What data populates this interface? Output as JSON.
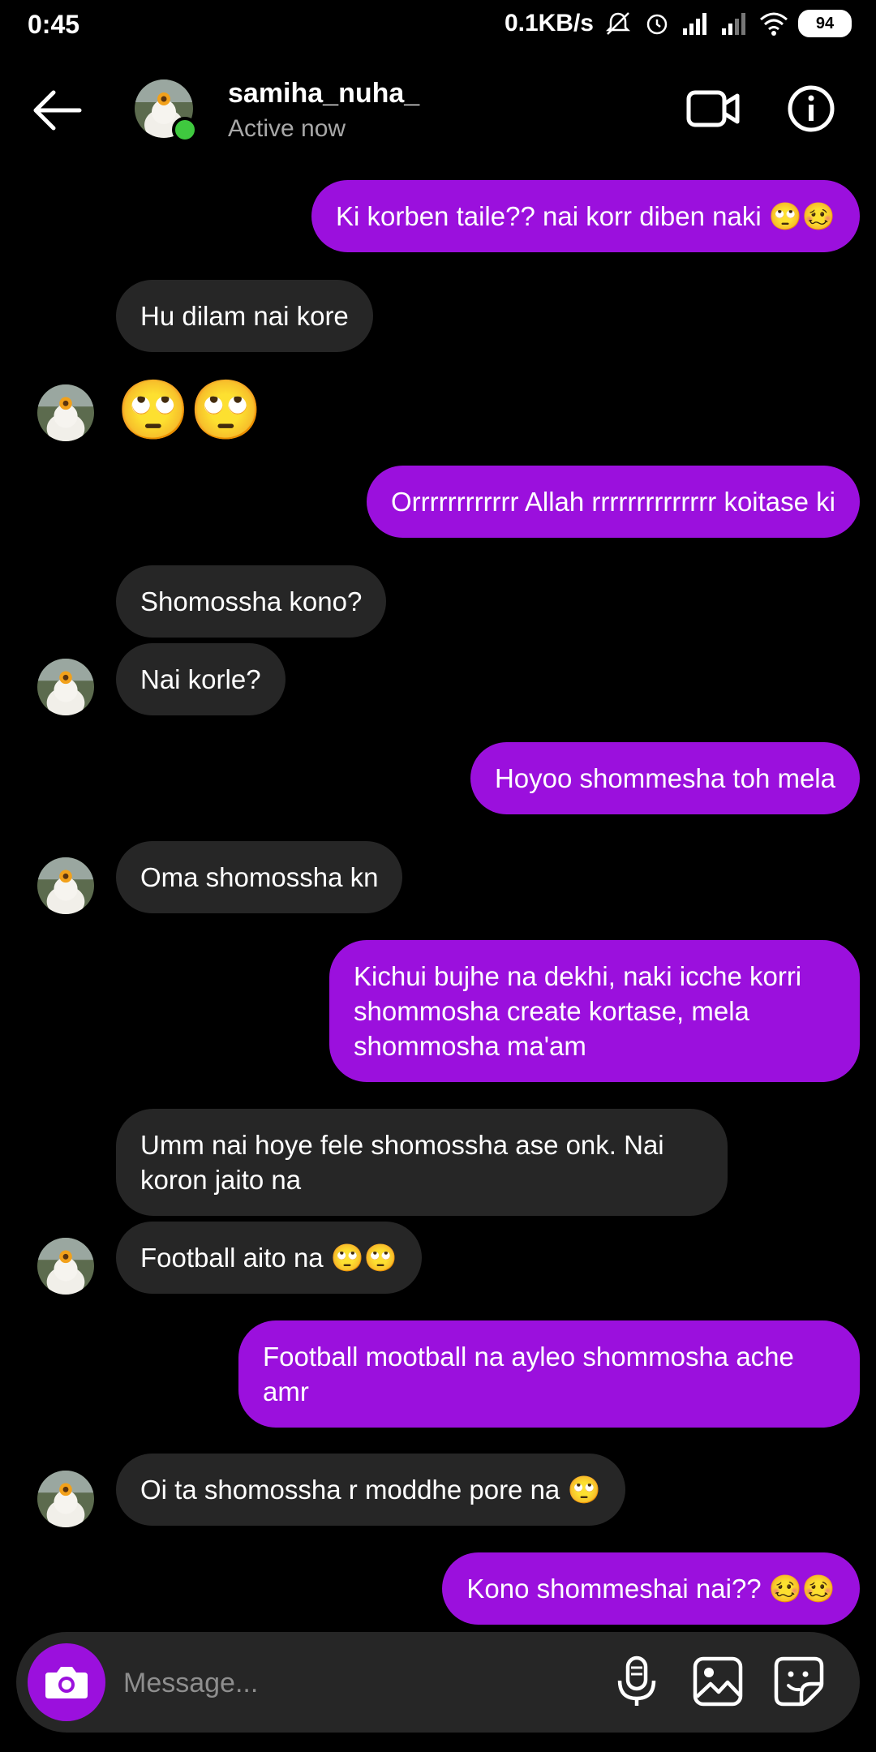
{
  "status_bar": {
    "time": "0:45",
    "net_speed": "0.1KB/s",
    "battery": "94"
  },
  "header": {
    "contact_name": "samiha_nuha_",
    "contact_status": "Active now"
  },
  "messages": [
    {
      "text": "Ki korben taile?? nai korr diben naki 🙄🥴"
    },
    {
      "text": "Hu dilam nai kore"
    },
    {
      "text": "🙄🙄"
    },
    {
      "text": "Orrrrrrrrrrrr Allah rrrrrrrrrrrrrr koitase ki"
    },
    {
      "text": "Shomossha kono?"
    },
    {
      "text": "Nai korle?"
    },
    {
      "text": "Hoyoo shommesha toh mela"
    },
    {
      "text": "Oma shomossha kn"
    },
    {
      "text": "Kichui bujhe na dekhi, naki icche korri shommosha create kortase, mela shommosha ma'am"
    },
    {
      "text": "Umm nai hoye fele shomossha ase onk. Nai koron jaito na"
    },
    {
      "text": "Football aito na 🙄🙄"
    },
    {
      "text": "Football mootball na ayleo shommosha ache amr"
    },
    {
      "text": "Oi ta shomossha r moddhe pore na 🙄"
    },
    {
      "text": "Kono shommeshai nai?? 🥴🥴"
    }
  ],
  "composer": {
    "placeholder": "Message..."
  },
  "icons": {
    "back": "back-arrow-icon",
    "video": "video-camera-icon",
    "info": "info-icon",
    "camera": "camera-icon",
    "mic": "microphone-icon",
    "gallery": "gallery-icon",
    "sticker": "sticker-icon"
  },
  "colors": {
    "outgoing_bubble": "#9b10dd",
    "incoming_bubble": "#262626",
    "online": "#3fc93f",
    "background": "#000000"
  }
}
